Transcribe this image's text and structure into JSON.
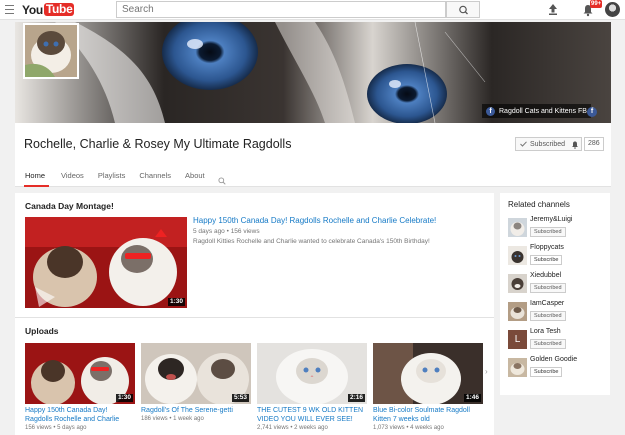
{
  "topbar": {
    "logo_you": "You",
    "logo_tube": "Tube",
    "search_placeholder": "Search",
    "notification_badge": "99+"
  },
  "banner": {
    "fb_label": "Ragdoll Cats and Kittens FB"
  },
  "channel": {
    "title": "Rochelle, Charlie & Rosey My Ultimate Ragdolls",
    "subscribed_label": "Subscribed",
    "subscriber_count": "286",
    "tabs": [
      "Home",
      "Videos",
      "Playlists",
      "Channels",
      "About"
    ]
  },
  "featured": {
    "section_title": "Canada Day Montage!",
    "title": "Happy 150th Canada Day! Ragdolls Rochelle and Charlie Celebrate!",
    "meta": "5 days ago  •  156 views",
    "description": "Ragdoll Kitties Rochelle and Charlie wanted to celebrate Canada's 150th Birthday!",
    "duration": "1:30"
  },
  "uploads": {
    "section_title": "Uploads",
    "items": [
      {
        "title": "Happy 150th Canada Day! Ragdolls Rochelle and Charlie",
        "meta": "156 views  •  5 days ago",
        "duration": "1:30"
      },
      {
        "title": "Ragdoll's Of The Serene-getti",
        "meta": "186 views  •  1 week ago",
        "duration": "5:53"
      },
      {
        "title": "THE CUTEST 9 WK OLD KITTEN VIDEO YOU WILL EVER SEE!",
        "meta": "2,741 views  •  2 weeks ago",
        "duration": "2:16"
      },
      {
        "title": "Blue Bi-color Soulmate Ragdoll Kitten 7 weeks old",
        "meta": "1,073 views  •  4 weeks ago",
        "duration": "1:46"
      }
    ]
  },
  "related": {
    "title": "Related channels",
    "items": [
      {
        "name": "Jeremy&Luigi",
        "button": "Subscribed"
      },
      {
        "name": "Floppycats",
        "button": "Subscribe"
      },
      {
        "name": "Xiedubbel",
        "button": "Subscribed"
      },
      {
        "name": "IamCasper",
        "button": "Subscribed"
      },
      {
        "name": "Lora Tesh",
        "button": "Subscribed",
        "initial": "L"
      },
      {
        "name": "Golden Goodie",
        "button": "Subscribe"
      }
    ]
  },
  "colors": {
    "brand_red": "#e52d27",
    "link_blue": "#167ac6"
  }
}
